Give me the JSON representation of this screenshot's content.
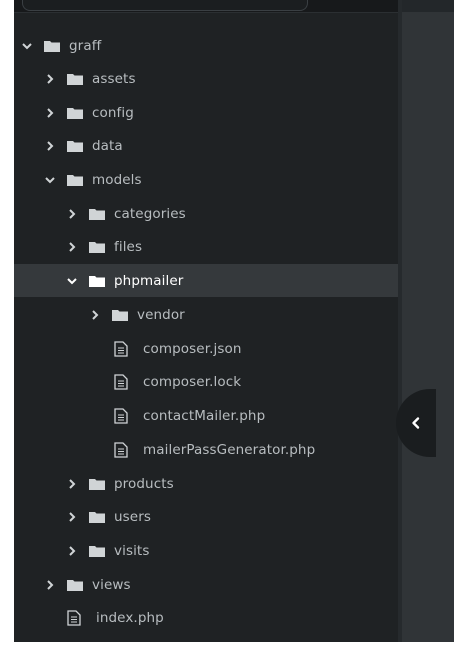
{
  "tree": {
    "rows": [
      {
        "label": "graff",
        "kind": "folder",
        "expanded": true
      },
      {
        "label": "assets",
        "kind": "folder",
        "expanded": false
      },
      {
        "label": "config",
        "kind": "folder",
        "expanded": false
      },
      {
        "label": "data",
        "kind": "folder",
        "expanded": false
      },
      {
        "label": "models",
        "kind": "folder",
        "expanded": true
      },
      {
        "label": "categories",
        "kind": "folder",
        "expanded": false
      },
      {
        "label": "files",
        "kind": "folder",
        "expanded": false
      },
      {
        "label": "phpmailer",
        "kind": "folder",
        "expanded": true,
        "selected": true
      },
      {
        "label": "vendor",
        "kind": "folder",
        "expanded": false
      },
      {
        "label": "composer.json",
        "kind": "file"
      },
      {
        "label": "composer.lock",
        "kind": "file"
      },
      {
        "label": "contactMailer.php",
        "kind": "file"
      },
      {
        "label": "mailerPassGenerator.php",
        "kind": "file"
      },
      {
        "label": "products",
        "kind": "folder",
        "expanded": false
      },
      {
        "label": "users",
        "kind": "folder",
        "expanded": false
      },
      {
        "label": "visits",
        "kind": "folder",
        "expanded": false
      },
      {
        "label": "views",
        "kind": "folder",
        "expanded": false
      },
      {
        "label": "index.php",
        "kind": "file"
      }
    ]
  },
  "collapse_button": {
    "icon": "chevron-left-icon"
  },
  "colors": {
    "panel_bg": "#1f2224",
    "selected_row_bg": "#35393c",
    "text": "#b8bdc0",
    "selected_text": "#ffffff",
    "icon": "#d0d4d6"
  }
}
